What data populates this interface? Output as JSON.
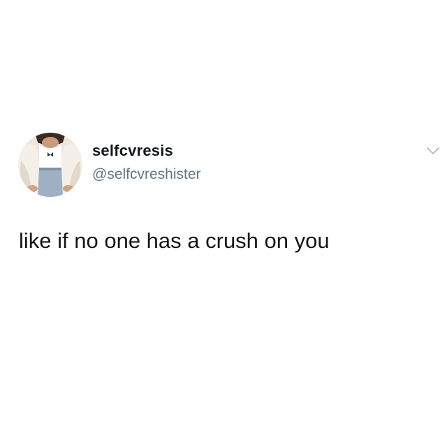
{
  "tweet": {
    "author": {
      "display_name": "selfcvresis",
      "handle": "@selfcvreshister",
      "avatar_icon": "profile-photo"
    },
    "text": "like if no one has a crush on you",
    "menu_icon": "chevron-down-icon"
  },
  "colors": {
    "background": "#ffffff",
    "name_text": "#14171a",
    "handle_text": "#657786",
    "chevron": "#aab8c2"
  }
}
